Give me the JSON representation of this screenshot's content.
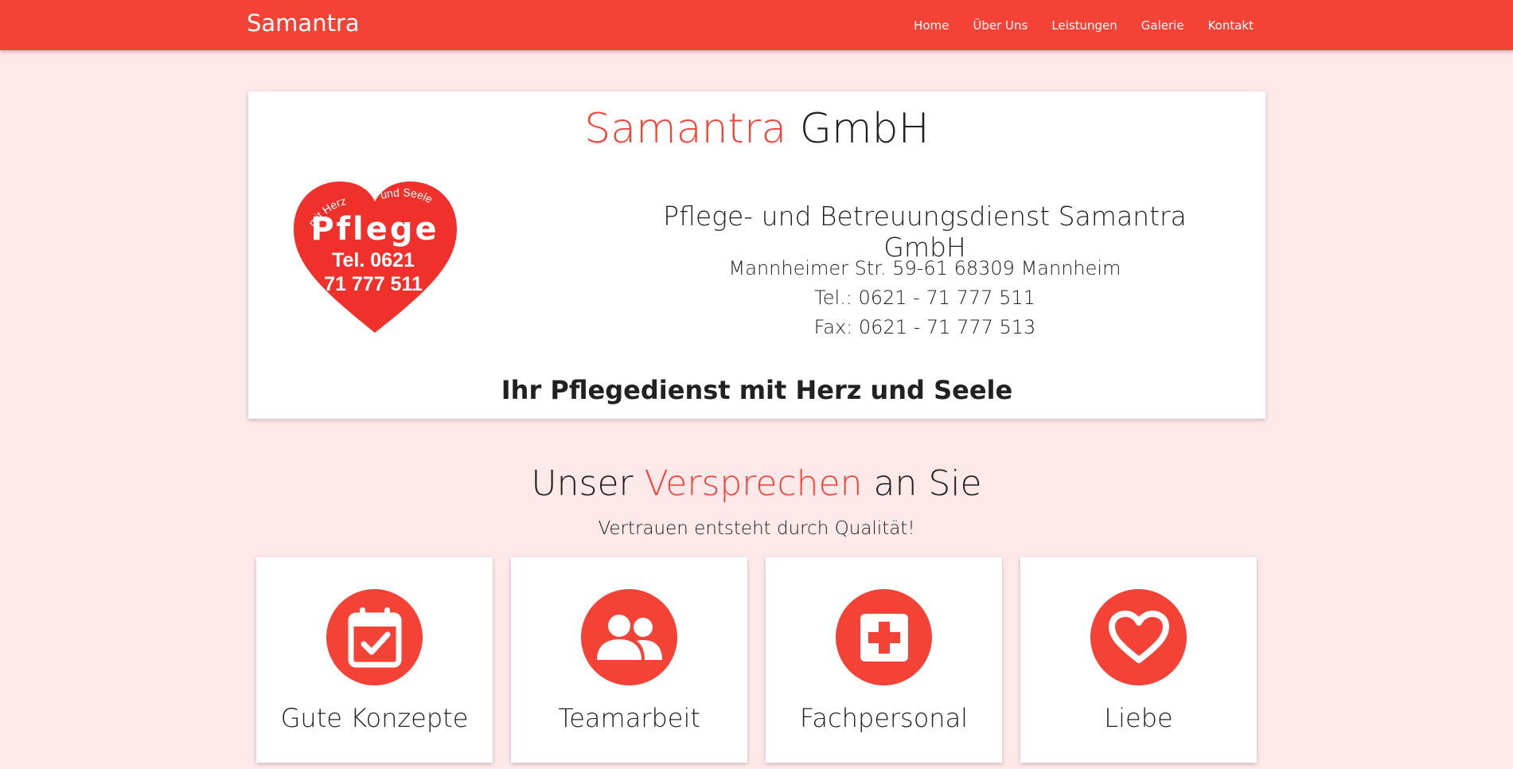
{
  "navbar": {
    "brand": "Samantra",
    "links": [
      "Home",
      "Über Uns",
      "Leistungen",
      "Galerie",
      "Kontakt"
    ]
  },
  "hero": {
    "title_accent": "Samantra",
    "title_rest": " GmbH",
    "logo": {
      "arc_left": "mit Herz",
      "arc_right": "und Seele",
      "word": "Pflege",
      "tel_line1": "Tel. 0621",
      "tel_line2": "71 777 511"
    },
    "company_name": "Pflege- und Betreuungsdienst Samantra GmbH",
    "address": "Mannheimer Str. 59-61 68309 Mannheim",
    "phone": "Tel.: 0621 - 71 777 511",
    "fax": "Fax: 0621 - 71 777 513",
    "tagline": "Ihr Pflegedienst mit Herz und Seele"
  },
  "promise": {
    "title_pre": "Unser ",
    "title_accent": "Versprechen",
    "title_post": " an Sie",
    "subtitle": "Vertrauen entsteht durch Qualität!"
  },
  "features": [
    {
      "label": "Gute Konzepte",
      "icon": "calendar-check-icon"
    },
    {
      "label": "Teamarbeit",
      "icon": "people-icon"
    },
    {
      "label": "Fachpersonal",
      "icon": "medical-cross-icon"
    },
    {
      "label": "Liebe",
      "icon": "heart-icon"
    }
  ],
  "colors": {
    "accent": "#f44336",
    "background": "#fde8ea",
    "card": "#ffffff"
  }
}
